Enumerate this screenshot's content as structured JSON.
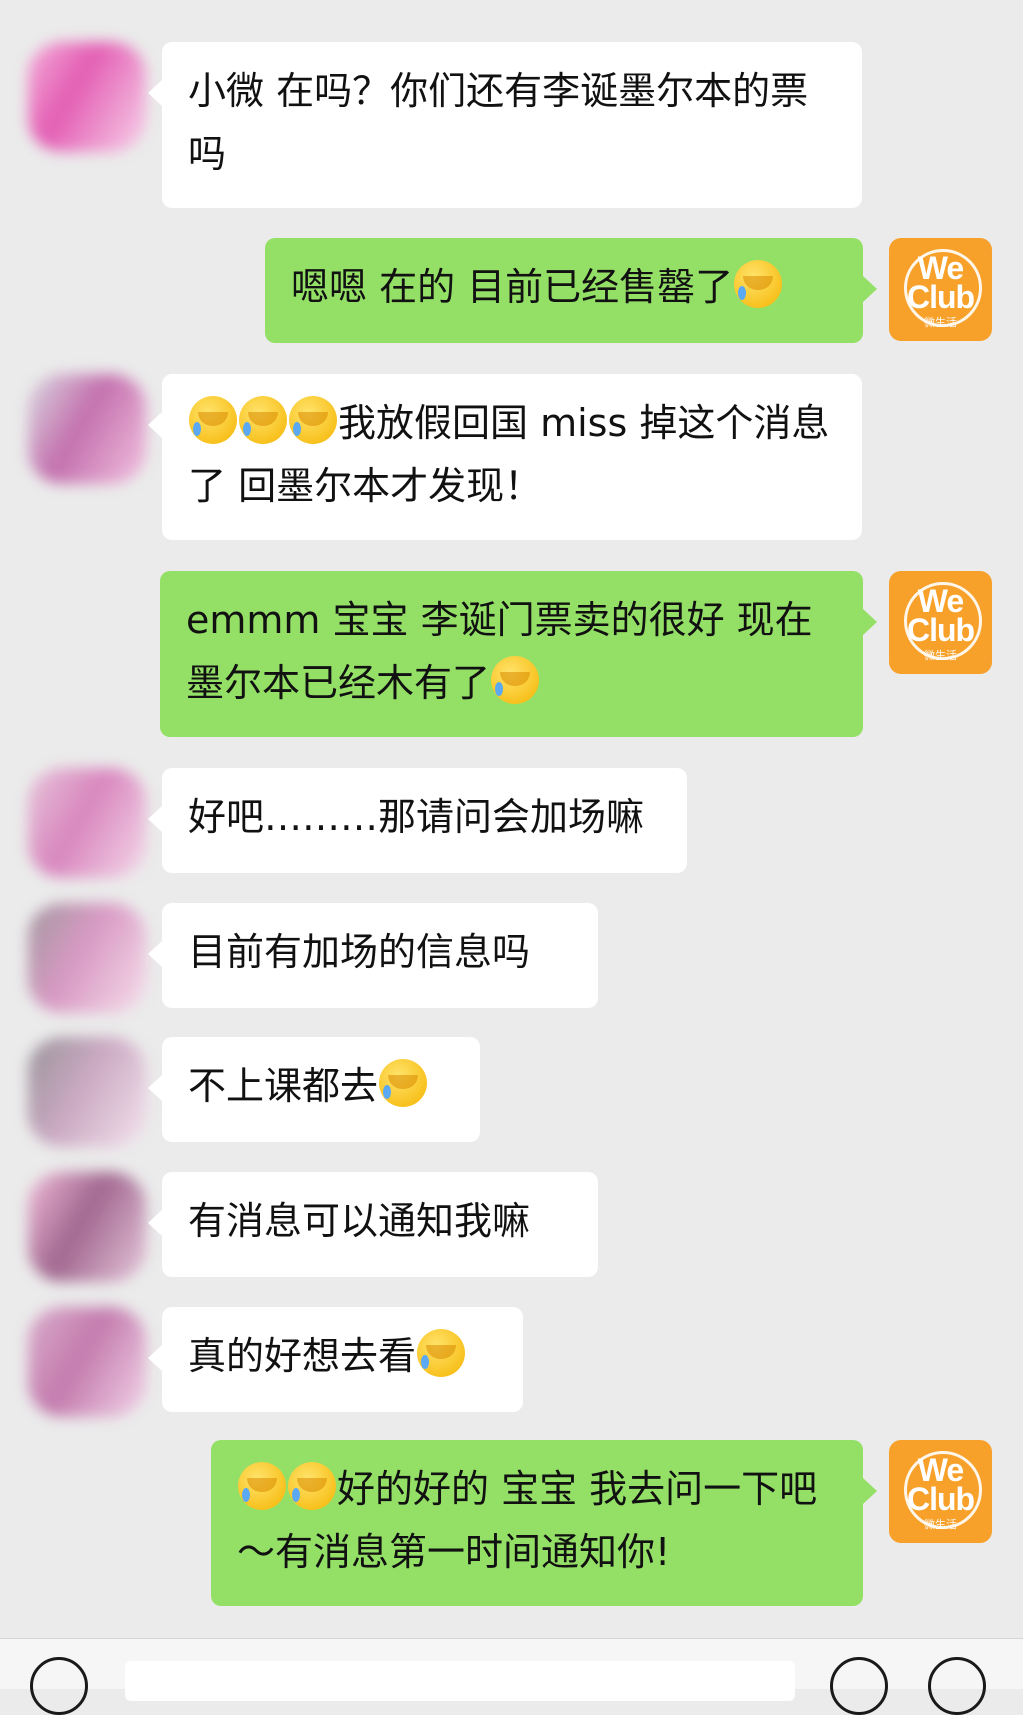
{
  "conversation": [
    {
      "side": "in",
      "text": "小微 在吗？你们还有李诞墨尔本的票吗"
    },
    {
      "side": "out",
      "text": "嗯嗯 在的 目前已经售罄了",
      "emoji": "face-palm-emoji"
    },
    {
      "side": "in",
      "prefix_emoji_count": 3,
      "text": "我放假回国 miss 掉这个消息了 回墨尔本才发现！"
    },
    {
      "side": "out",
      "text": "emmm 宝宝 李诞门票卖的很好 现在墨尔本已经木有了",
      "emoji": "face-palm-emoji"
    },
    {
      "side": "in",
      "text": "好吧………那请问会加场嘛"
    },
    {
      "side": "in",
      "text": "目前有加场的信息吗"
    },
    {
      "side": "in",
      "text": "不上课都去",
      "emoji": "tears-of-joy-emoji"
    },
    {
      "side": "in",
      "text": "有消息可以通知我嘛"
    },
    {
      "side": "in",
      "text": "真的好想去看",
      "emoji": "face-palm-emoji"
    },
    {
      "side": "out",
      "prefix_emoji_count": 2,
      "text": "好的好的 宝宝 我去问一下吧～有消息第一时间通知你!"
    }
  ],
  "brand_avatar": {
    "line1": "We",
    "line2": "Club",
    "line3": "微生活",
    "color": "#f7a12a"
  },
  "colors": {
    "outgoing_bubble": "#94e067",
    "incoming_bubble": "#ffffff",
    "background": "#ebebeb"
  }
}
